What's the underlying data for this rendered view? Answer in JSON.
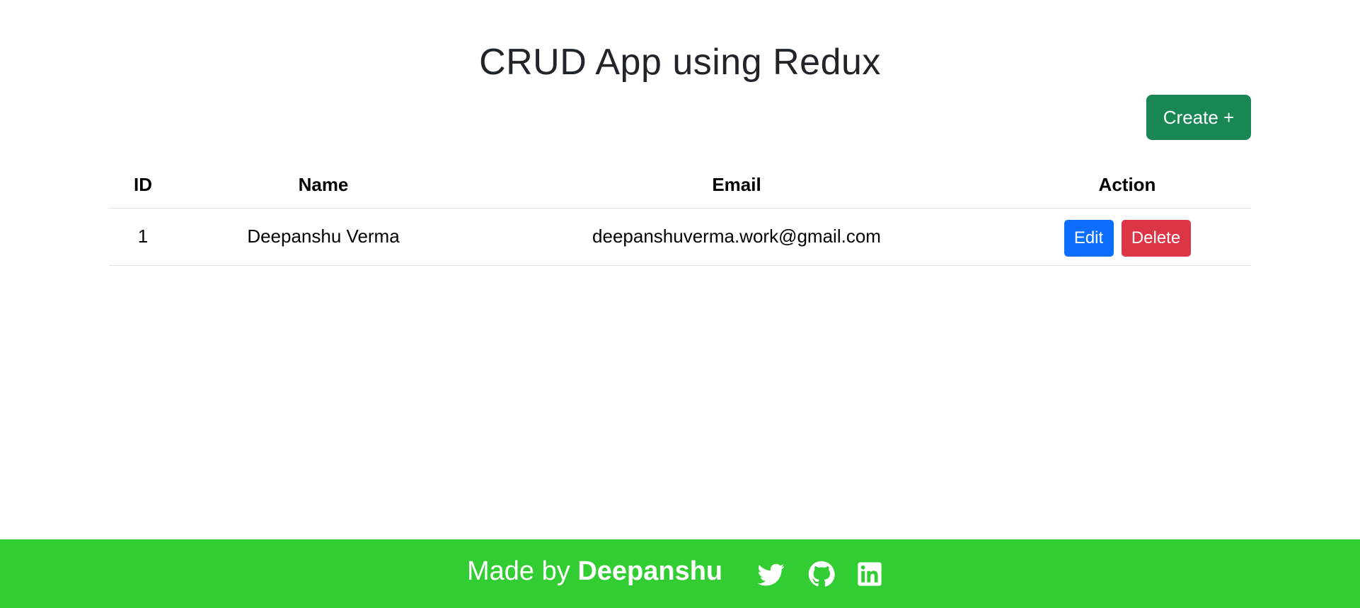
{
  "app": {
    "title": "CRUD App using Redux"
  },
  "toolbar": {
    "create_label": "Create +"
  },
  "table": {
    "headers": {
      "id": "ID",
      "name": "Name",
      "email": "Email",
      "action": "Action"
    },
    "rows": [
      {
        "id": "1",
        "name": "Deepanshu Verma",
        "email": "deepanshuverma.work@gmail.com",
        "edit_label": "Edit",
        "delete_label": "Delete"
      }
    ]
  },
  "footer": {
    "made_by_prefix": "Made by",
    "author": "Deepanshu",
    "background_color": "#32cd32",
    "social_icons": [
      "twitter-icon",
      "github-icon",
      "linkedin-icon"
    ]
  },
  "colors": {
    "create_button": "#198754",
    "edit_button": "#0d6efd",
    "delete_button": "#dc3545"
  }
}
